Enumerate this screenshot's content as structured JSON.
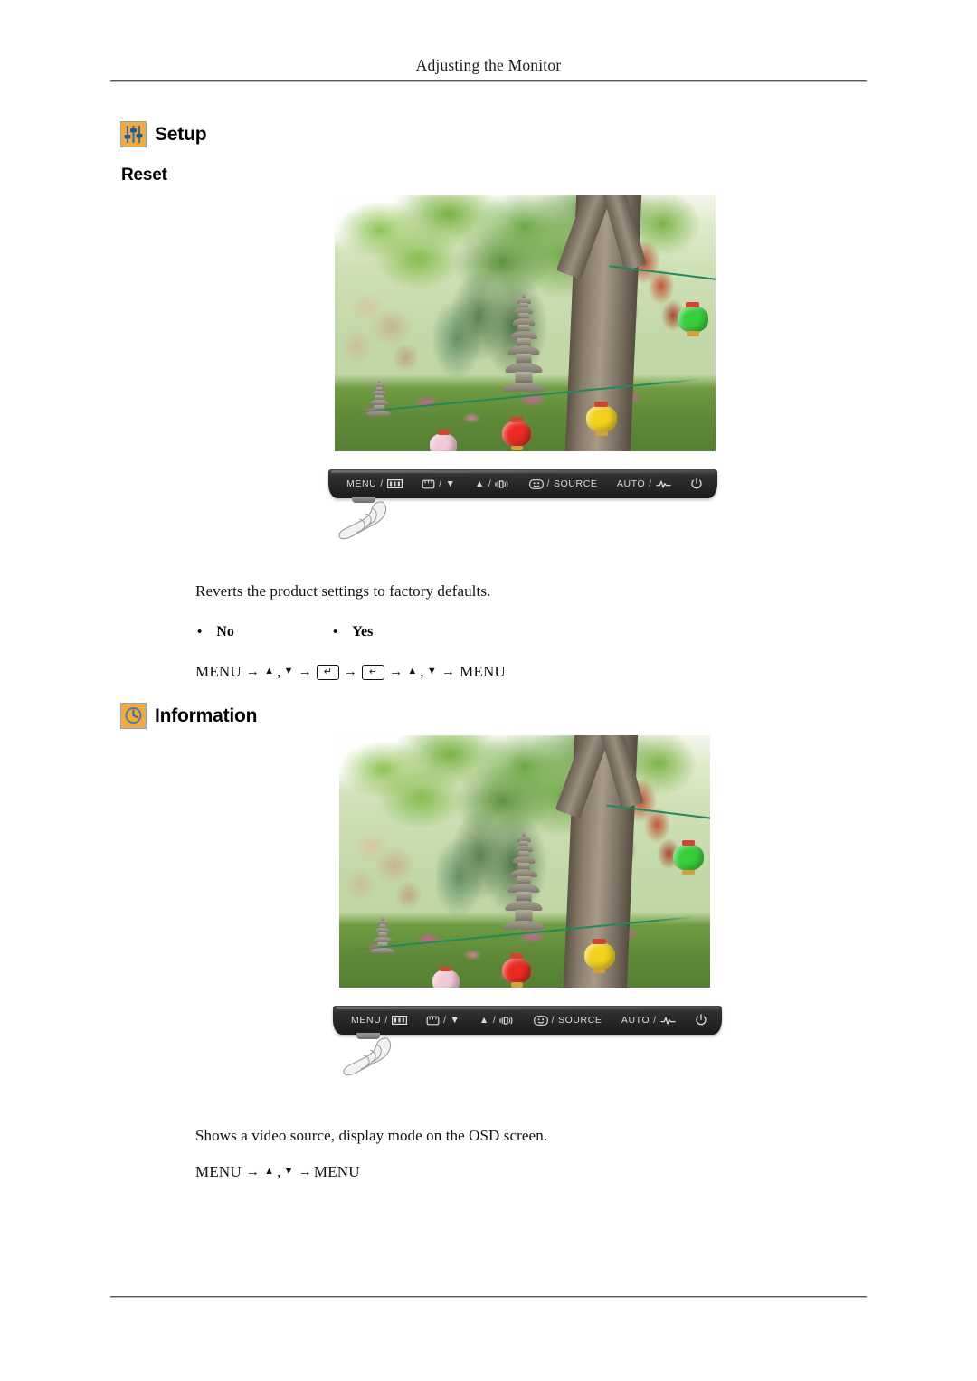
{
  "page": {
    "header_title": "Adjusting the Monitor",
    "accent_icon_bg": "#f4a93d",
    "icon_border": "#7fa8cf"
  },
  "sections": [
    {
      "id": "setup",
      "icon_name": "sliders-icon",
      "title": "Setup",
      "subtitle": "Reset",
      "description": "Reverts the product settings to factory defaults.",
      "options": [
        {
          "bullet": "•",
          "label": "No"
        },
        {
          "bullet": "•",
          "label": "Yes"
        }
      ],
      "nav_sequence": {
        "start": "MENU",
        "up": "▲",
        "comma": ",",
        "down": "▼",
        "arrow": "→",
        "enter": "↵",
        "end": "MENU"
      }
    },
    {
      "id": "information",
      "icon_name": "info-clock-icon",
      "title": "Information",
      "description": "Shows a video source, display mode on the OSD screen.",
      "nav_sequence": {
        "start": "MENU",
        "up": "▲",
        "comma": ",",
        "down": "▼",
        "arrow": "→",
        "end": "MENU"
      }
    }
  ],
  "monitor_controls": {
    "buttons": [
      {
        "name": "menu-button",
        "label": "MENU",
        "separator": "/",
        "icon": "osd-menu-icon",
        "trailing_label": ""
      },
      {
        "name": "down-button",
        "label": "",
        "separator": "/",
        "icon": "image-icon",
        "trailing_label": "▼"
      },
      {
        "name": "up-button",
        "label": "▲",
        "separator": "/",
        "icon": "volume-icon",
        "trailing_label": ""
      },
      {
        "name": "source-button",
        "label": "",
        "separator": "/",
        "icon": "enter-icon",
        "trailing_label": "SOURCE"
      },
      {
        "name": "auto-button",
        "label": "AUTO",
        "separator": "/",
        "icon": "magicbright-icon",
        "trailing_label": ""
      },
      {
        "name": "power-button",
        "label": "",
        "separator": "",
        "icon": "power-icon",
        "trailing_label": ""
      }
    ]
  },
  "photo": {
    "name": "temple-garden-photo",
    "alt": "Korean temple garden with stone pagodas, paper lanterns and trees"
  }
}
